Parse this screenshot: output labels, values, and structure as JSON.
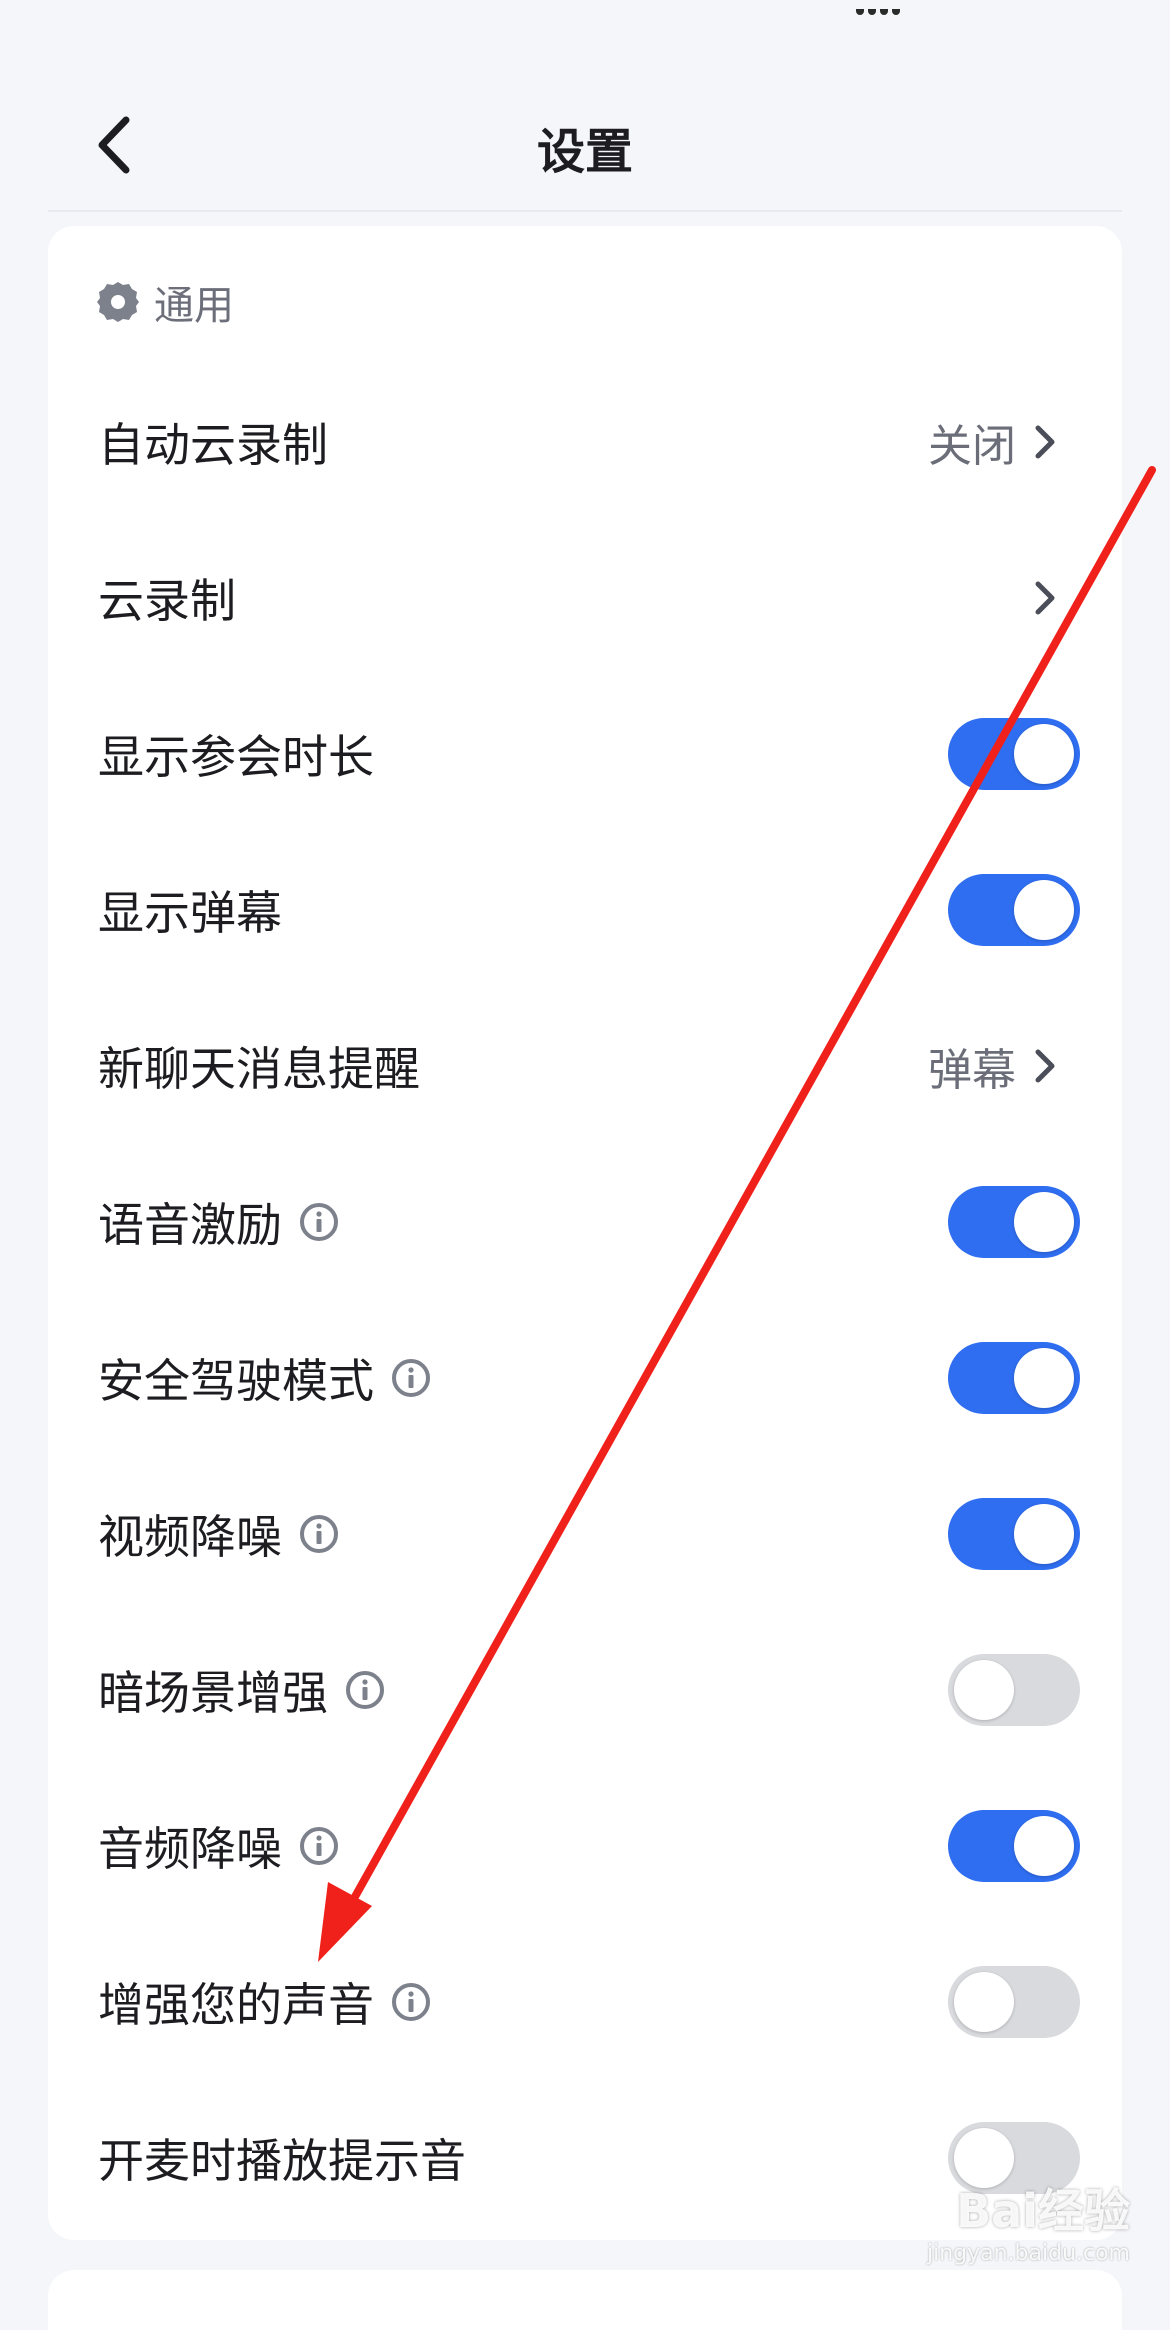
{
  "header": {
    "title": "设置"
  },
  "section": {
    "title": "通用",
    "icon": "gear-icon"
  },
  "rows": [
    {
      "name": "auto-cloud-record",
      "label": "自动云录制",
      "type": "link",
      "value": "关闭",
      "info": false
    },
    {
      "name": "cloud-record",
      "label": "云录制",
      "type": "link",
      "value": "",
      "info": false
    },
    {
      "name": "show-meeting-duration",
      "label": "显示参会时长",
      "type": "toggle",
      "on": true,
      "info": false
    },
    {
      "name": "show-danmaku",
      "label": "显示弹幕",
      "type": "toggle",
      "on": true,
      "info": false
    },
    {
      "name": "new-chat-reminder",
      "label": "新聊天消息提醒",
      "type": "link",
      "value": "弹幕",
      "info": false
    },
    {
      "name": "voice-incentive",
      "label": "语音激励",
      "type": "toggle",
      "on": true,
      "info": true
    },
    {
      "name": "safe-driving-mode",
      "label": "安全驾驶模式",
      "type": "toggle",
      "on": true,
      "info": true
    },
    {
      "name": "video-noise-reduction",
      "label": "视频降噪",
      "type": "toggle",
      "on": true,
      "info": true
    },
    {
      "name": "low-light-enhance",
      "label": "暗场景增强",
      "type": "toggle",
      "on": false,
      "info": true
    },
    {
      "name": "audio-noise-reduction",
      "label": "音频降噪",
      "type": "toggle",
      "on": true,
      "info": true
    },
    {
      "name": "enhance-voice",
      "label": "增强您的声音",
      "type": "toggle",
      "on": false,
      "info": true
    },
    {
      "name": "mic-on-sound",
      "label": "开麦时播放提示音",
      "type": "toggle",
      "on": false,
      "info": false
    }
  ],
  "colors": {
    "accent": "#2f6ef0",
    "toggle_off": "#d9dade",
    "annotation": "#f0201a"
  },
  "watermark": {
    "main": "Bai经验",
    "sub": "jingyan.baidu.com"
  }
}
